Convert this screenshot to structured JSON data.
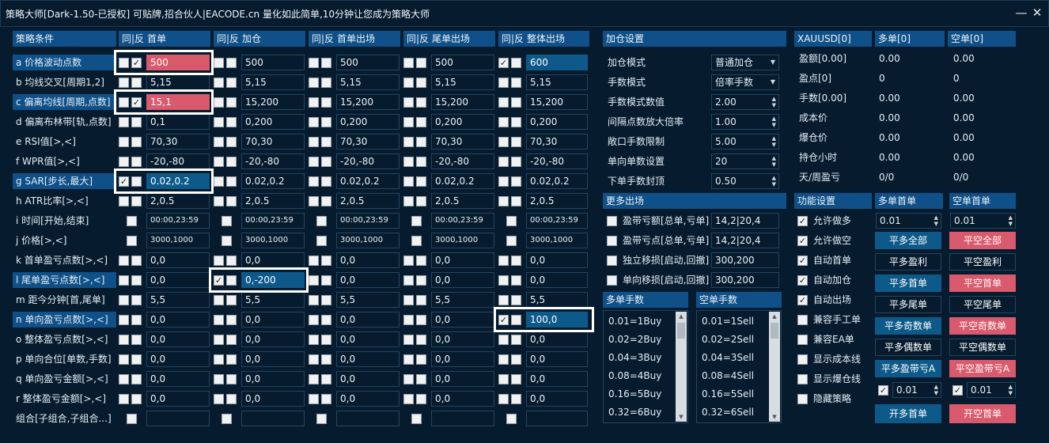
{
  "window": {
    "title": "策略大师[Dark-1.50-已授权]  可贴牌,招合伙人|EACODE.cn  量化如此简单,10分钟让您成为策略大师"
  },
  "table": {
    "col_condition": "策略条件",
    "col_headers": [
      "首单",
      "加仓",
      "首单出场",
      "尾单出场",
      "整体出场"
    ],
    "col_prefix": "同|反",
    "rows": [
      {
        "label": "a 价格波动点数",
        "hl": true,
        "vals": [
          "500",
          "500",
          "500",
          "500",
          "600"
        ],
        "checks": [
          [
            false,
            true
          ],
          [
            false,
            false
          ],
          [
            false,
            false
          ],
          [
            false,
            false
          ],
          [
            true,
            false
          ]
        ]
      },
      {
        "label": "b 均线交叉[周期1,2]",
        "vals": [
          "5,15",
          "5,15",
          "5,15",
          "5,15",
          "5,15"
        ]
      },
      {
        "label": "c 偏离均线[周期,点数]",
        "hl": true,
        "vals": [
          "15,1",
          "15,200",
          "15,200",
          "15,200",
          "15,200"
        ],
        "checks": [
          [
            false,
            true
          ],
          [
            false,
            false
          ],
          [
            false,
            false
          ],
          [
            false,
            false
          ],
          [
            false,
            false
          ]
        ]
      },
      {
        "label": "d 偏离布林带[轨,点数]",
        "vals": [
          "0,1",
          "0,200",
          "0,200",
          "0,200",
          "0,200"
        ]
      },
      {
        "label": "e RSI值[>,<]",
        "vals": [
          "70,30",
          "70,30",
          "70,30",
          "70,30",
          "70,30"
        ]
      },
      {
        "label": "f WPR值[>,<]",
        "vals": [
          "-20,-80",
          "-20,-80",
          "-20,-80",
          "-20,-80",
          "-20,-80"
        ]
      },
      {
        "label": "g SAR[步长,最大]",
        "hl": true,
        "vals": [
          "0.02,0.2",
          "0.02,0.2",
          "0.02,0.2",
          "0.02,0.2",
          "0.02,0.2"
        ],
        "checks": [
          [
            true,
            false
          ],
          [
            false,
            false
          ],
          [
            false,
            false
          ],
          [
            false,
            false
          ],
          [
            false,
            false
          ]
        ]
      },
      {
        "label": "h ATR比率[>,<]",
        "vals": [
          "2,0.5",
          "2,0.5",
          "2,0.5",
          "2,0.5",
          "2,0.5"
        ]
      },
      {
        "label": "i 时间[开始,结束]",
        "vals": [
          "00:00,23:59",
          "00:00,23:59",
          "00:00,23:59",
          "00:00,23:59",
          "00:00,23:59"
        ],
        "single": true
      },
      {
        "label": "j 价格[>,<]",
        "vals": [
          "3000,1000",
          "3000,1000",
          "3000,1000",
          "3000,1000",
          "3000,1000"
        ],
        "single": true
      },
      {
        "label": "k 首单盈亏点数[>,<]",
        "vals": [
          "0,0",
          "0,0",
          "0,0",
          "0,0",
          "0,0"
        ]
      },
      {
        "label": "l 尾单盈亏点数[>,<]",
        "hl": true,
        "vals": [
          "0,0",
          "0,-200",
          "0,0",
          "0,0",
          "0,0"
        ],
        "checks": [
          [
            false,
            false
          ],
          [
            true,
            false
          ],
          [
            false,
            false
          ],
          [
            false,
            false
          ],
          [
            false,
            false
          ]
        ]
      },
      {
        "label": "m 距今分钟[首,尾单]",
        "vals": [
          "5,5",
          "5,5",
          "5,5",
          "5,5",
          "5,5"
        ]
      },
      {
        "label": "n 单向盈亏点数[>,<]",
        "hl": true,
        "vals": [
          "0,0",
          "0,0",
          "0,0",
          "0,0",
          "100,0"
        ],
        "checks": [
          [
            false,
            false
          ],
          [
            false,
            false
          ],
          [
            false,
            false
          ],
          [
            false,
            false
          ],
          [
            true,
            false
          ]
        ]
      },
      {
        "label": "o 整体盈亏点数[>,<]",
        "vals": [
          "0,0",
          "0,0",
          "0,0",
          "0,0",
          "0,0"
        ]
      },
      {
        "label": "p 单向合位[单数,手数]",
        "vals": [
          "0,0",
          "0,0",
          "0,0",
          "0,0",
          "0,0"
        ]
      },
      {
        "label": "q 单向盈亏金额[>,<]",
        "vals": [
          "0,0",
          "0,0",
          "0,0",
          "0,0",
          "0,0"
        ]
      },
      {
        "label": "r 整体盈亏金额[>,<]",
        "vals": [
          "0,0",
          "0,0",
          "0,0",
          "0,0",
          "0,0"
        ]
      },
      {
        "label": "组合[子组合,子组合...]",
        "vals": [
          "",
          "",
          "",
          "",
          ""
        ],
        "single": true
      }
    ]
  },
  "add_settings": {
    "header": "加仓设置",
    "items": [
      {
        "label": "加仓模式",
        "value": "普通加仓",
        "kind": "select"
      },
      {
        "label": "手数模式",
        "value": "倍率手数",
        "kind": "select"
      },
      {
        "label": "手数模式数值",
        "value": "2.00",
        "kind": "spin"
      },
      {
        "label": "间隔点数放大倍率",
        "value": "1.00",
        "kind": "spin"
      },
      {
        "label": "敞口手数限制",
        "value": "5.00",
        "kind": "spin"
      },
      {
        "label": "单向单数设置",
        "value": "20",
        "kind": "spin"
      },
      {
        "label": "下单手数封顶",
        "value": "0.50",
        "kind": "spin"
      }
    ]
  },
  "more_exit": {
    "header": "更多出场",
    "items": [
      {
        "label": "盈带亏额[总单,亏单]",
        "value": "14,2|20,4"
      },
      {
        "label": "盈带亏点[总单,亏单]",
        "value": "14,2|20,4"
      },
      {
        "label": "独立移损[启动,回撤]",
        "value": "300,200"
      },
      {
        "label": "单向移损[启动,回撤]",
        "value": "300,200"
      }
    ]
  },
  "lot_lists": {
    "buy_header": "多单手数",
    "sell_header": "空单手数",
    "buy": [
      "0.01=1Buy",
      "0.02=2Buy",
      "0.04=3Buy",
      "0.08=4Buy",
      "0.16=5Buy",
      "0.32=6Buy"
    ],
    "sell": [
      "0.01=1Sell",
      "0.02=2Sell",
      "0.04=3Sell",
      "0.08=4Sell",
      "0.16=5Sell",
      "0.32=6Sell"
    ]
  },
  "stats": {
    "headers": [
      "XAUUSD[0]",
      "多单[0]",
      "空单[0]"
    ],
    "rows": [
      {
        "label": "盈额[0.00]",
        "buy": "0.00",
        "sell": "0.00"
      },
      {
        "label": "盈点[0]",
        "buy": "0",
        "sell": "0"
      },
      {
        "label": "手数[0.00]",
        "buy": "0.00",
        "sell": "0.00"
      },
      {
        "label": "成本价",
        "buy": "0.00",
        "sell": "0.00"
      },
      {
        "label": "爆仓价",
        "buy": "0.00",
        "sell": "0.00"
      },
      {
        "label": "持仓小时",
        "buy": "0.00",
        "sell": "0.00"
      },
      {
        "label": "天/周盈亏",
        "buy": "0/0",
        "sell": "0/0"
      }
    ]
  },
  "functions": {
    "header": "功能设置",
    "items": [
      {
        "label": "允许做多",
        "checked": true
      },
      {
        "label": "允许做空",
        "checked": true
      },
      {
        "label": "自动首单",
        "checked": true
      },
      {
        "label": "自动加仓",
        "checked": true
      },
      {
        "label": "自动出场",
        "checked": true
      },
      {
        "label": "兼容手工单",
        "checked": false
      },
      {
        "label": "兼容EA单",
        "checked": false
      },
      {
        "label": "显示成本线",
        "checked": false
      },
      {
        "label": "显示爆仓线",
        "checked": false
      },
      {
        "label": "隐藏策略",
        "checked": false
      }
    ]
  },
  "buy_first": {
    "header": "多单首单",
    "lot": "0.01",
    "buttons": [
      {
        "label": "平多全部",
        "style": "b"
      },
      {
        "label": "平多盈利",
        "style": "d"
      },
      {
        "label": "平多首单",
        "style": "b"
      },
      {
        "label": "平多尾单",
        "style": "d"
      },
      {
        "label": "平多奇数单",
        "style": "b"
      },
      {
        "label": "平多偶数单",
        "style": "d"
      },
      {
        "label": "平多盈带亏A",
        "style": "b"
      }
    ],
    "bottom_lot": "0.01",
    "open_button": "开多首单"
  },
  "sell_first": {
    "header": "空单首单",
    "lot": "0.01",
    "buttons": [
      {
        "label": "平空全部",
        "style": "r"
      },
      {
        "label": "平空盈利",
        "style": "d"
      },
      {
        "label": "平空首单",
        "style": "r"
      },
      {
        "label": "平空尾单",
        "style": "d"
      },
      {
        "label": "平空奇数单",
        "style": "r"
      },
      {
        "label": "平空偶数单",
        "style": "d"
      },
      {
        "label": "平空盈带亏A",
        "style": "r"
      }
    ],
    "bottom_lot": "0.01",
    "open_button": "开空首单"
  }
}
